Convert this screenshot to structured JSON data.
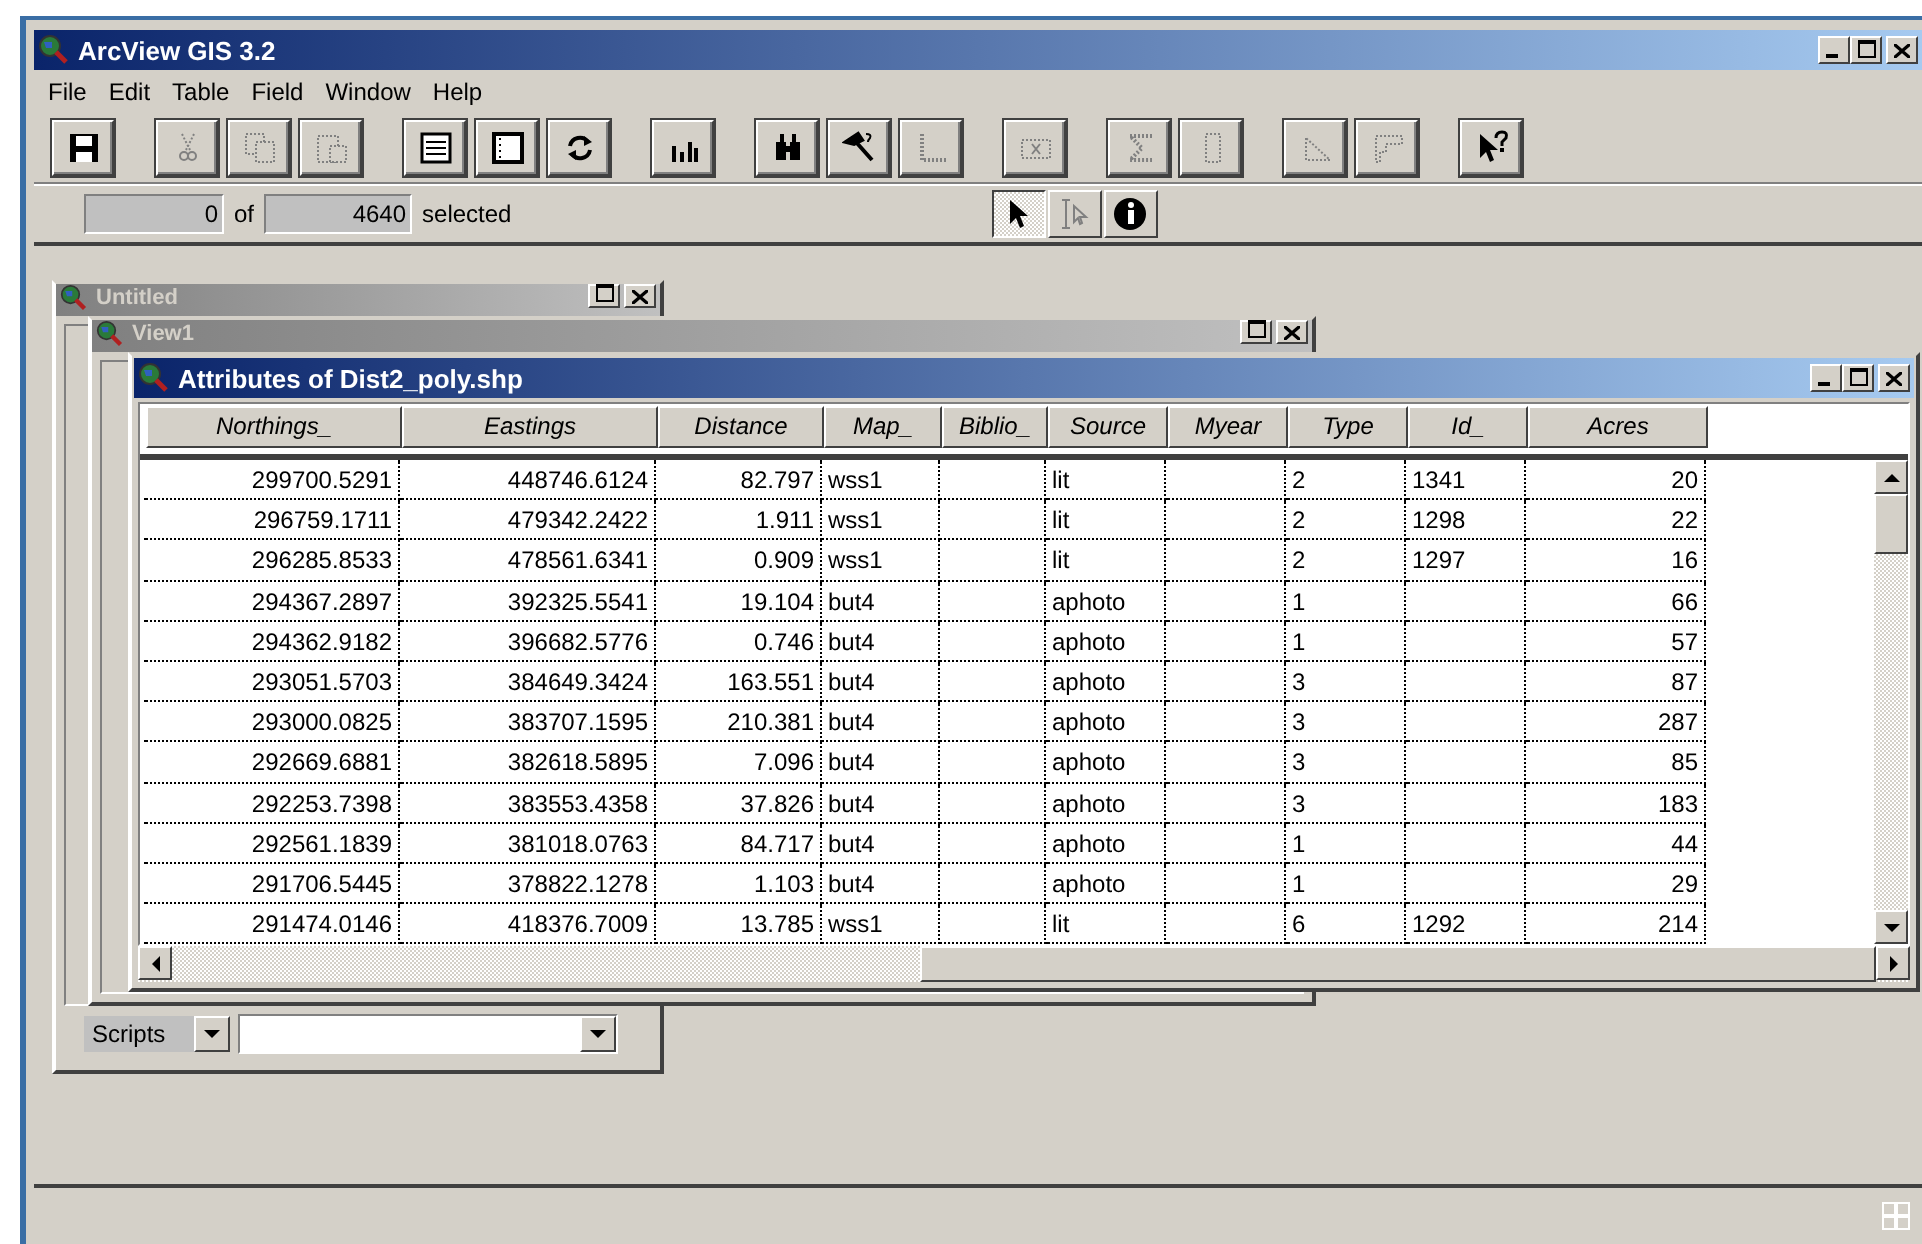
{
  "window": {
    "title": "ArcView GIS 3.2",
    "active": true,
    "controls": [
      {
        "kind": "minimize"
      },
      {
        "kind": "maximize"
      },
      {
        "kind": "close"
      }
    ]
  },
  "menu": [
    "File",
    "Edit",
    "Table",
    "Field",
    "Window",
    "Help"
  ],
  "toolbar": [
    {
      "kind": "save",
      "disabled": false
    },
    {
      "kind": "cut",
      "disabled": true
    },
    {
      "kind": "copy",
      "disabled": true
    },
    {
      "kind": "paste",
      "disabled": true
    },
    {
      "kind": "list",
      "disabled": false
    },
    {
      "kind": "panel",
      "disabled": false
    },
    {
      "kind": "refresh",
      "disabled": false
    },
    {
      "kind": "chart",
      "disabled": false
    },
    {
      "kind": "find",
      "disabled": false
    },
    {
      "kind": "hammer",
      "disabled": false
    },
    {
      "kind": "axis",
      "disabled": true
    },
    {
      "kind": "join",
      "disabled": true
    },
    {
      "kind": "sum",
      "disabled": true
    },
    {
      "kind": "calc",
      "disabled": true
    },
    {
      "kind": "sort-asc",
      "disabled": true
    },
    {
      "kind": "sort-desc",
      "disabled": true
    },
    {
      "kind": "help",
      "disabled": false
    }
  ],
  "selection": {
    "count": "0",
    "of": "of",
    "total": "4640",
    "label": "selected"
  },
  "tools": [
    {
      "kind": "pointer",
      "selected": true,
      "disabled": false
    },
    {
      "kind": "select",
      "selected": false,
      "disabled": true
    },
    {
      "kind": "info",
      "selected": false,
      "disabled": false
    }
  ],
  "windows": [
    {
      "title": "Untitled",
      "active": false,
      "controls": [
        {
          "kind": "maximize"
        },
        {
          "kind": "close"
        }
      ],
      "scripts": {
        "label": "Scripts"
      }
    },
    {
      "title": "View1",
      "active": false,
      "controls": [
        {
          "kind": "maximize"
        },
        {
          "kind": "close"
        }
      ]
    }
  ],
  "attributes": {
    "title": "Attributes of Dist2_poly.shp",
    "active": true,
    "controls": [
      {
        "kind": "minimize"
      },
      {
        "kind": "maximize"
      },
      {
        "kind": "close"
      }
    ],
    "columns": [
      {
        "label": "Northings_"
      },
      {
        "label": "Eastings"
      },
      {
        "label": "Distance"
      },
      {
        "label": "Map_"
      },
      {
        "label": "Biblio_"
      },
      {
        "label": "Source"
      },
      {
        "label": "Myear"
      },
      {
        "label": "Type"
      },
      {
        "label": "Id_"
      },
      {
        "label": "Acres"
      }
    ],
    "rows": [
      [
        "299700.5291",
        "448746.6124",
        "82.797",
        "wss1",
        null,
        "lit",
        null,
        "2",
        "1341",
        "20"
      ],
      [
        "296759.1711",
        "479342.2422",
        "1.911",
        "wss1",
        null,
        "lit",
        null,
        "2",
        "1298",
        "22"
      ],
      [
        "296285.8533",
        "478561.6341",
        "0.909",
        "wss1",
        null,
        "lit",
        null,
        "2",
        "1297",
        "16"
      ],
      [
        "294367.2897",
        "392325.5541",
        "19.104",
        "but4",
        null,
        "aphoto",
        null,
        "1",
        null,
        "66"
      ],
      [
        "294362.9182",
        "396682.5776",
        "0.746",
        "but4",
        null,
        "aphoto",
        null,
        "1",
        null,
        "57"
      ],
      [
        "293051.5703",
        "384649.3424",
        "163.551",
        "but4",
        null,
        "aphoto",
        null,
        "3",
        null,
        "87"
      ],
      [
        "293000.0825",
        "383707.1595",
        "210.381",
        "but4",
        null,
        "aphoto",
        null,
        "3",
        null,
        "287"
      ],
      [
        "292669.6881",
        "382618.5895",
        "7.096",
        "but4",
        null,
        "aphoto",
        null,
        "3",
        null,
        "85"
      ],
      [
        "292253.7398",
        "383553.4358",
        "37.826",
        "but4",
        null,
        "aphoto",
        null,
        "3",
        null,
        "183"
      ],
      [
        "292561.1839",
        "381018.0763",
        "84.717",
        "but4",
        null,
        "aphoto",
        null,
        "1",
        null,
        "44"
      ],
      [
        "291706.5445",
        "378822.1278",
        "1.103",
        "but4",
        null,
        "aphoto",
        null,
        "1",
        null,
        "29"
      ],
      [
        "291474.0146",
        "418376.7009",
        "13.785",
        "wss1",
        null,
        "lit",
        null,
        "6",
        "1292",
        "214"
      ]
    ]
  }
}
